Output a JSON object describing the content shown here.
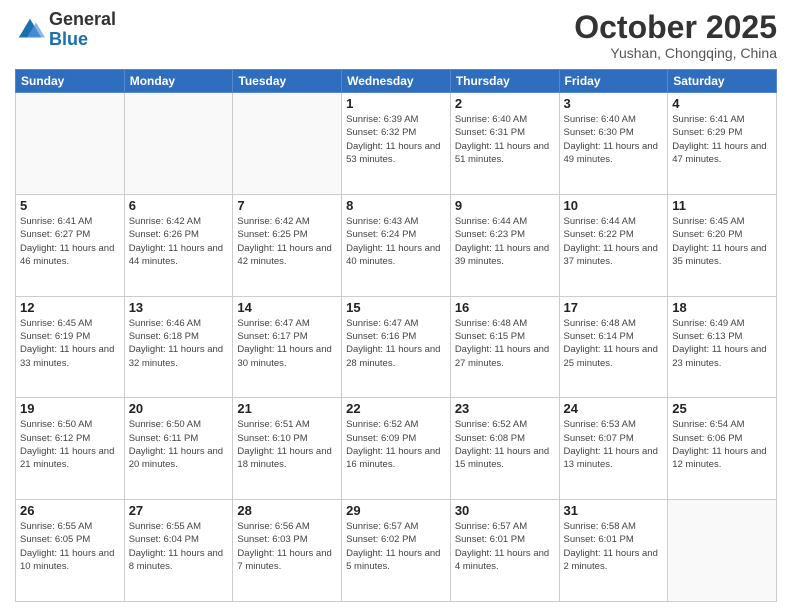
{
  "header": {
    "logo_general": "General",
    "logo_blue": "Blue",
    "month_title": "October 2025",
    "subtitle": "Yushan, Chongqing, China"
  },
  "weekdays": [
    "Sunday",
    "Monday",
    "Tuesday",
    "Wednesday",
    "Thursday",
    "Friday",
    "Saturday"
  ],
  "weeks": [
    [
      {
        "day": "",
        "info": ""
      },
      {
        "day": "",
        "info": ""
      },
      {
        "day": "",
        "info": ""
      },
      {
        "day": "1",
        "info": "Sunrise: 6:39 AM\nSunset: 6:32 PM\nDaylight: 11 hours and 53 minutes."
      },
      {
        "day": "2",
        "info": "Sunrise: 6:40 AM\nSunset: 6:31 PM\nDaylight: 11 hours and 51 minutes."
      },
      {
        "day": "3",
        "info": "Sunrise: 6:40 AM\nSunset: 6:30 PM\nDaylight: 11 hours and 49 minutes."
      },
      {
        "day": "4",
        "info": "Sunrise: 6:41 AM\nSunset: 6:29 PM\nDaylight: 11 hours and 47 minutes."
      }
    ],
    [
      {
        "day": "5",
        "info": "Sunrise: 6:41 AM\nSunset: 6:27 PM\nDaylight: 11 hours and 46 minutes."
      },
      {
        "day": "6",
        "info": "Sunrise: 6:42 AM\nSunset: 6:26 PM\nDaylight: 11 hours and 44 minutes."
      },
      {
        "day": "7",
        "info": "Sunrise: 6:42 AM\nSunset: 6:25 PM\nDaylight: 11 hours and 42 minutes."
      },
      {
        "day": "8",
        "info": "Sunrise: 6:43 AM\nSunset: 6:24 PM\nDaylight: 11 hours and 40 minutes."
      },
      {
        "day": "9",
        "info": "Sunrise: 6:44 AM\nSunset: 6:23 PM\nDaylight: 11 hours and 39 minutes."
      },
      {
        "day": "10",
        "info": "Sunrise: 6:44 AM\nSunset: 6:22 PM\nDaylight: 11 hours and 37 minutes."
      },
      {
        "day": "11",
        "info": "Sunrise: 6:45 AM\nSunset: 6:20 PM\nDaylight: 11 hours and 35 minutes."
      }
    ],
    [
      {
        "day": "12",
        "info": "Sunrise: 6:45 AM\nSunset: 6:19 PM\nDaylight: 11 hours and 33 minutes."
      },
      {
        "day": "13",
        "info": "Sunrise: 6:46 AM\nSunset: 6:18 PM\nDaylight: 11 hours and 32 minutes."
      },
      {
        "day": "14",
        "info": "Sunrise: 6:47 AM\nSunset: 6:17 PM\nDaylight: 11 hours and 30 minutes."
      },
      {
        "day": "15",
        "info": "Sunrise: 6:47 AM\nSunset: 6:16 PM\nDaylight: 11 hours and 28 minutes."
      },
      {
        "day": "16",
        "info": "Sunrise: 6:48 AM\nSunset: 6:15 PM\nDaylight: 11 hours and 27 minutes."
      },
      {
        "day": "17",
        "info": "Sunrise: 6:48 AM\nSunset: 6:14 PM\nDaylight: 11 hours and 25 minutes."
      },
      {
        "day": "18",
        "info": "Sunrise: 6:49 AM\nSunset: 6:13 PM\nDaylight: 11 hours and 23 minutes."
      }
    ],
    [
      {
        "day": "19",
        "info": "Sunrise: 6:50 AM\nSunset: 6:12 PM\nDaylight: 11 hours and 21 minutes."
      },
      {
        "day": "20",
        "info": "Sunrise: 6:50 AM\nSunset: 6:11 PM\nDaylight: 11 hours and 20 minutes."
      },
      {
        "day": "21",
        "info": "Sunrise: 6:51 AM\nSunset: 6:10 PM\nDaylight: 11 hours and 18 minutes."
      },
      {
        "day": "22",
        "info": "Sunrise: 6:52 AM\nSunset: 6:09 PM\nDaylight: 11 hours and 16 minutes."
      },
      {
        "day": "23",
        "info": "Sunrise: 6:52 AM\nSunset: 6:08 PM\nDaylight: 11 hours and 15 minutes."
      },
      {
        "day": "24",
        "info": "Sunrise: 6:53 AM\nSunset: 6:07 PM\nDaylight: 11 hours and 13 minutes."
      },
      {
        "day": "25",
        "info": "Sunrise: 6:54 AM\nSunset: 6:06 PM\nDaylight: 11 hours and 12 minutes."
      }
    ],
    [
      {
        "day": "26",
        "info": "Sunrise: 6:55 AM\nSunset: 6:05 PM\nDaylight: 11 hours and 10 minutes."
      },
      {
        "day": "27",
        "info": "Sunrise: 6:55 AM\nSunset: 6:04 PM\nDaylight: 11 hours and 8 minutes."
      },
      {
        "day": "28",
        "info": "Sunrise: 6:56 AM\nSunset: 6:03 PM\nDaylight: 11 hours and 7 minutes."
      },
      {
        "day": "29",
        "info": "Sunrise: 6:57 AM\nSunset: 6:02 PM\nDaylight: 11 hours and 5 minutes."
      },
      {
        "day": "30",
        "info": "Sunrise: 6:57 AM\nSunset: 6:01 PM\nDaylight: 11 hours and 4 minutes."
      },
      {
        "day": "31",
        "info": "Sunrise: 6:58 AM\nSunset: 6:01 PM\nDaylight: 11 hours and 2 minutes."
      },
      {
        "day": "",
        "info": ""
      }
    ]
  ]
}
